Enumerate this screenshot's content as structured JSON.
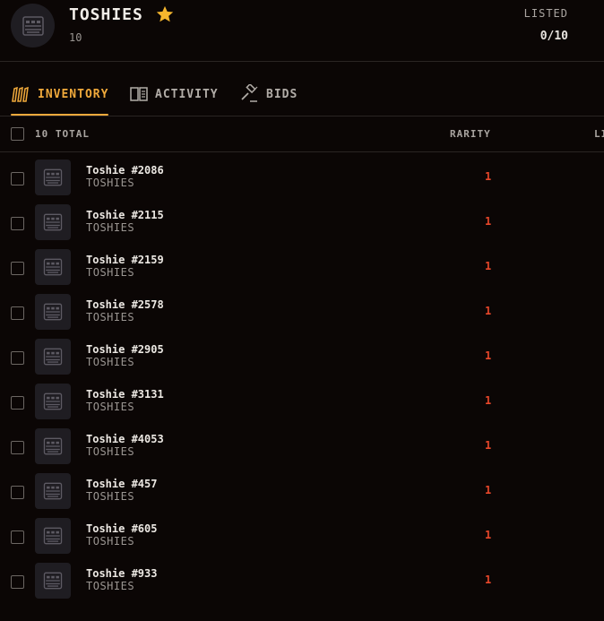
{
  "collection": {
    "title": "TOSHIES",
    "count": "10",
    "listed_label": "LISTED",
    "listed_value": "0/10"
  },
  "tabs": [
    {
      "label": "INVENTORY",
      "active": true,
      "icon": "inventory-icon"
    },
    {
      "label": "ACTIVITY",
      "active": false,
      "icon": "book-icon"
    },
    {
      "label": "BIDS",
      "active": false,
      "icon": "gavel-icon"
    }
  ],
  "table": {
    "total_label": "10 TOTAL",
    "columns": [
      "RARITY",
      "LI"
    ]
  },
  "items": [
    {
      "name": "Toshie #2086",
      "collection": "TOSHIES",
      "rarity": "1"
    },
    {
      "name": "Toshie #2115",
      "collection": "TOSHIES",
      "rarity": "1"
    },
    {
      "name": "Toshie #2159",
      "collection": "TOSHIES",
      "rarity": "1"
    },
    {
      "name": "Toshie #2578",
      "collection": "TOSHIES",
      "rarity": "1"
    },
    {
      "name": "Toshie #2905",
      "collection": "TOSHIES",
      "rarity": "1"
    },
    {
      "name": "Toshie #3131",
      "collection": "TOSHIES",
      "rarity": "1"
    },
    {
      "name": "Toshie #4053",
      "collection": "TOSHIES",
      "rarity": "1"
    },
    {
      "name": "Toshie #457",
      "collection": "TOSHIES",
      "rarity": "1"
    },
    {
      "name": "Toshie #605",
      "collection": "TOSHIES",
      "rarity": "1"
    },
    {
      "name": "Toshie #933",
      "collection": "TOSHIES",
      "rarity": "1"
    }
  ],
  "colors": {
    "background": "#0b0605",
    "accent": "#f0a93b",
    "star": "#f5b62d",
    "rarity": "#e8472a",
    "thumb_bg": "#1f1d22"
  }
}
